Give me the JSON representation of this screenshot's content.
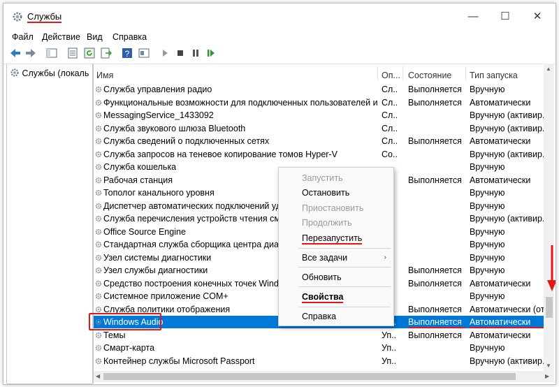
{
  "window": {
    "title": "Службы",
    "minimize": "—",
    "maximize": "☐",
    "close": "✕"
  },
  "menu": [
    "Файл",
    "Действие",
    "Вид",
    "Справка"
  ],
  "tree": {
    "label": "Службы (локаль"
  },
  "columns": {
    "name": "Имя",
    "desc": "Оп...",
    "state": "Состояние",
    "start": "Тип запуска"
  },
  "rows": [
    {
      "name": "Служба управления радио",
      "desc": "Сл...",
      "state": "Выполняется",
      "start": "Вручную"
    },
    {
      "name": "Функциональные возможности для подключенных пользователей и теле...",
      "desc": "Сл...",
      "state": "Выполняется",
      "start": "Автоматически"
    },
    {
      "name": "MessagingService_1433092",
      "desc": "Сл...",
      "state": "",
      "start": "Вручную (активир..."
    },
    {
      "name": "Служба звукового шлюза Bluetooth",
      "desc": "Сл...",
      "state": "",
      "start": "Вручную (активир..."
    },
    {
      "name": "Служба сведений о подключенных сетях",
      "desc": "Сл...",
      "state": "Выполняется",
      "start": "Автоматически"
    },
    {
      "name": "Служба запросов на теневое копирование томов Hyper-V",
      "desc": "Со...",
      "state": "",
      "start": "Вручную (активир..."
    },
    {
      "name": "Служба кошелька",
      "desc": "",
      "state": "",
      "start": "Вручную"
    },
    {
      "name": "Рабочая станция",
      "desc": "",
      "state": "Выполняется",
      "start": "Автоматически"
    },
    {
      "name": "Тополог канального уровня",
      "desc": "",
      "state": "",
      "start": "Вручную"
    },
    {
      "name": "Диспетчер автоматических подключений удале",
      "desc": "",
      "state": "",
      "start": "Вручную"
    },
    {
      "name": "Служба перечисления устройств чтения смарт-",
      "desc": "",
      "state": "",
      "start": "Вручную (активир..."
    },
    {
      "name": "Office  Source Engine",
      "desc": "",
      "state": "",
      "start": "Вручную"
    },
    {
      "name": "Стандартная служба сборщика центра диагност",
      "desc": "",
      "state": "",
      "start": "Вручную"
    },
    {
      "name": "Узел системы диагностики",
      "desc": "",
      "state": "",
      "start": "Вручную"
    },
    {
      "name": "Узел службы диагностики",
      "desc": "",
      "state": "Выполняется",
      "start": "Вручную"
    },
    {
      "name": "Средство построения конечных точек Windows",
      "desc": "",
      "state": "Выполняется",
      "start": "Автоматически"
    },
    {
      "name": "Системное приложение COM+",
      "desc": "",
      "state": "",
      "start": "Вручную"
    },
    {
      "name": "Служба политики отображения",
      "desc": "",
      "state": "Выполняется",
      "start": "Автоматически (от..."
    },
    {
      "name": "Windows Audio",
      "desc": "Уп...",
      "state": "Выполняется",
      "start": "Автоматически"
    },
    {
      "name": "Темы",
      "desc": "Уп...",
      "state": "Выполняется",
      "start": "Автоматически"
    },
    {
      "name": "Смарт-карта",
      "desc": "Уп...",
      "state": "",
      "start": "Вручную"
    },
    {
      "name": "Контейнер службы Microsoft Passport",
      "desc": "Уп...",
      "state": "",
      "start": "Вручную (активир..."
    }
  ],
  "context_menu": {
    "start": "Запустить",
    "stop": "Остановить",
    "pause": "Приостановить",
    "resume": "Продолжить",
    "restart": "Перезапустить",
    "all_tasks": "Все задачи",
    "refresh": "Обновить",
    "properties": "Свойства",
    "help": "Справка"
  },
  "colors": {
    "selection": "#0078d7",
    "annotation": "#e01818"
  }
}
